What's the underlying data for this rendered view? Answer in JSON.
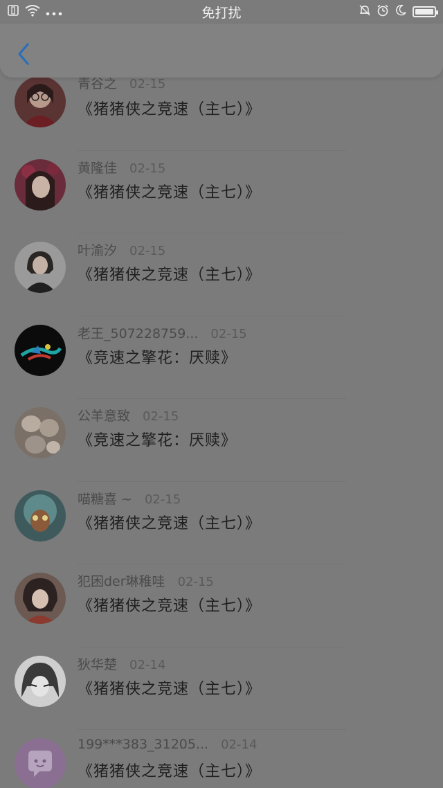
{
  "status_bar": {
    "center_text": "免打扰",
    "battery_level": 1.0,
    "icons_left": [
      "sim-icon",
      "wifi-icon",
      "more-dots-icon"
    ],
    "icons_right": [
      "mute-bell-icon",
      "alarm-icon",
      "moon-icon",
      "battery-icon"
    ]
  },
  "header": {
    "back_icon": "chevron-left-icon",
    "accent": "#2b6fb5"
  },
  "items": [
    {
      "name": "青谷之",
      "date": "02-15",
      "title": "《猪猪侠之竞速（主七）》",
      "avatar": "photo"
    },
    {
      "name": "黄隆佳",
      "date": "02-15",
      "title": "《猪猪侠之竞速（主七）》",
      "avatar": "photo"
    },
    {
      "name": "叶渝汐",
      "date": "02-15",
      "title": "《猪猪侠之竞速（主七）》",
      "avatar": "photo"
    },
    {
      "name": "老王_507228759...",
      "date": "02-15",
      "title": "《竞速之擎花：厌赎》",
      "avatar": "photo"
    },
    {
      "name": "公羊意致",
      "date": "02-15",
      "title": "《竞速之擎花：厌赎》",
      "avatar": "photo"
    },
    {
      "name": "喵糖喜 ~",
      "date": "02-15",
      "title": "《猪猪侠之竞速（主七）》",
      "avatar": "photo"
    },
    {
      "name": "犯困der琳稚哇",
      "date": "02-15",
      "title": "《猪猪侠之竞速（主七）》",
      "avatar": "photo"
    },
    {
      "name": "狄华楚",
      "date": "02-14",
      "title": "《猪猪侠之竞速（主七）》",
      "avatar": "photo"
    },
    {
      "name": "199***383_31205...",
      "date": "02-14",
      "title": "《猪猪侠之竞速（主七）》",
      "avatar": "default-avatar-icon"
    }
  ]
}
